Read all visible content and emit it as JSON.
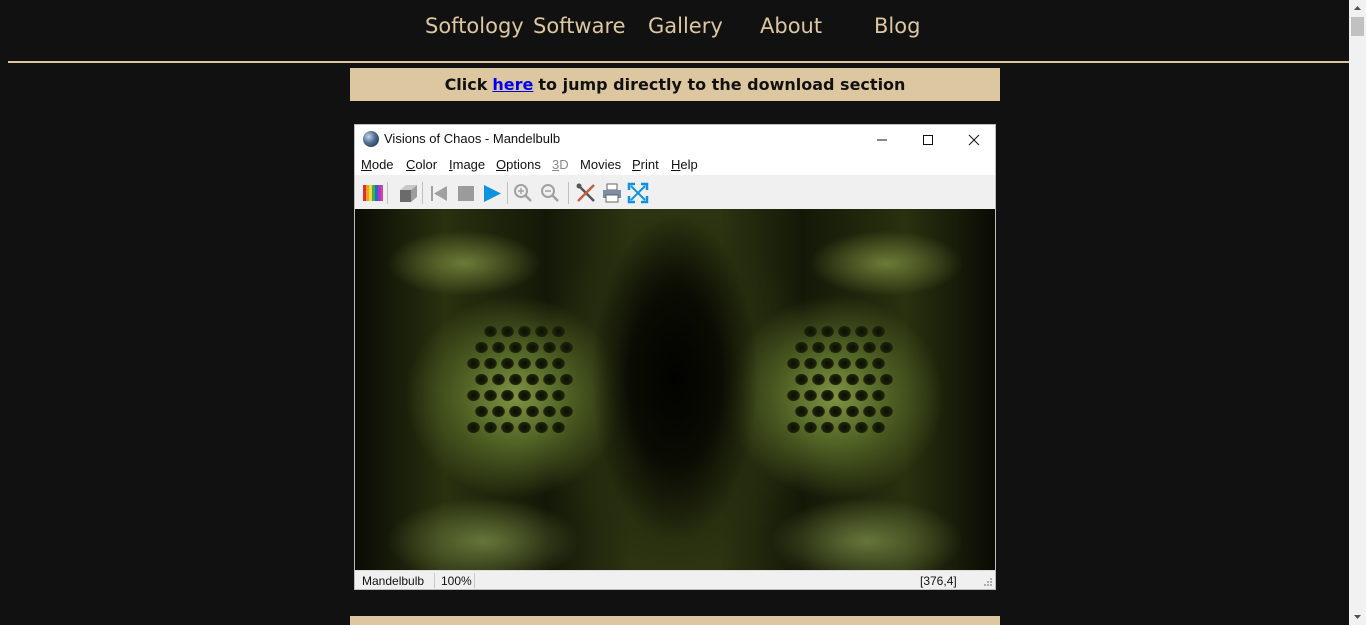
{
  "nav": {
    "items": [
      {
        "label": "Softology"
      },
      {
        "label": "Software"
      },
      {
        "label": "Gallery"
      },
      {
        "label": "About"
      },
      {
        "label": "Blog"
      }
    ]
  },
  "banner": {
    "prefix": "Click",
    "link_text": "here",
    "suffix": "to jump directly to the download section"
  },
  "window": {
    "title": "Visions of Chaos - Mandelbulb",
    "menu": [
      {
        "label": "Mode",
        "accel": "M",
        "rest": "ode",
        "enabled": true
      },
      {
        "label": "Color",
        "accel": "C",
        "rest": "olor",
        "enabled": true
      },
      {
        "label": "Image",
        "accel": "I",
        "rest": "mage",
        "enabled": true
      },
      {
        "label": "Options",
        "accel": "O",
        "rest": "ptions",
        "enabled": true
      },
      {
        "label": "3D",
        "accel": "3",
        "rest": "D",
        "enabled": false
      },
      {
        "label": "Movies",
        "accel": "Mo",
        "rest": "vies",
        "enabled": true
      },
      {
        "label": "Print",
        "accel": "P",
        "rest": "rint",
        "enabled": true
      },
      {
        "label": "Help",
        "accel": "H",
        "rest": "elp",
        "enabled": true
      }
    ],
    "toolbar_icons": [
      "palette-icon",
      "cube-icon",
      "skip-back-icon",
      "stop-icon",
      "play-icon",
      "zoom-in-icon",
      "zoom-out-icon",
      "tools-icon",
      "print-icon",
      "fullscreen-icon"
    ],
    "status": {
      "mode": "Mandelbulb",
      "zoom": "100%",
      "coords": "[376,4]"
    }
  },
  "colors": {
    "background": "#111111",
    "accent": "#dcc7a1",
    "link": "#0000ee",
    "play_blue": "#0b93e0"
  }
}
